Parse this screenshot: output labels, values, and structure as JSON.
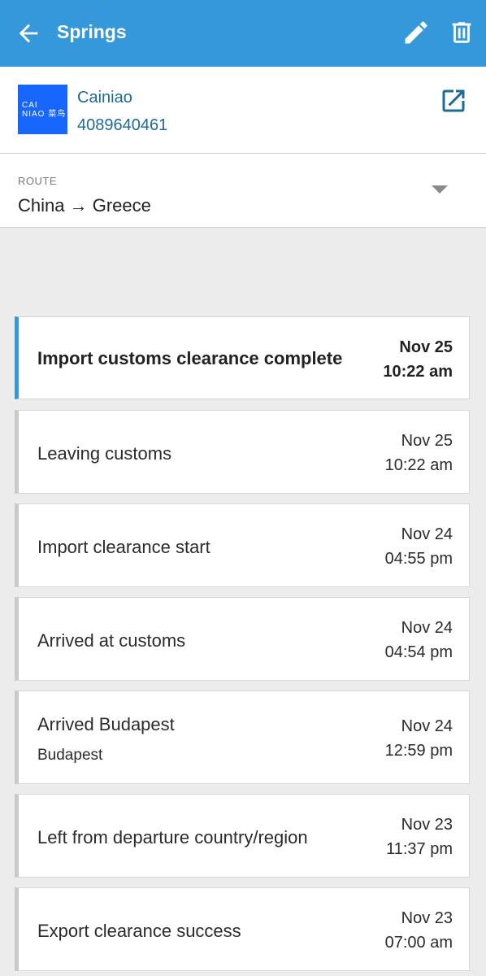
{
  "appbar": {
    "title": "Springs"
  },
  "carrier": {
    "logo_line1": "CAI",
    "logo_line2": "NIAO 菜鸟",
    "name": "Cainiao",
    "tracking_number": "4089640461"
  },
  "route": {
    "label": "ROUTE",
    "value": "China → Greece"
  },
  "events": [
    {
      "title": "Import customs clearance complete",
      "date": "Nov 25",
      "time": "10:22 am",
      "location": ""
    },
    {
      "title": "Leaving customs",
      "date": "Nov 25",
      "time": "10:22 am",
      "location": ""
    },
    {
      "title": "Import clearance start",
      "date": "Nov 24",
      "time": "04:55 pm",
      "location": ""
    },
    {
      "title": "Arrived at customs",
      "date": "Nov 24",
      "time": "04:54 pm",
      "location": ""
    },
    {
      "title": "Arrived Budapest",
      "date": "Nov 24",
      "time": "12:59 pm",
      "location": "Budapest"
    },
    {
      "title": "Left from departure country/region",
      "date": "Nov 23",
      "time": "11:37 pm",
      "location": ""
    },
    {
      "title": "Export clearance success",
      "date": "Nov 23",
      "time": "07:00 am",
      "location": ""
    }
  ],
  "colors": {
    "appbar": "#3598db",
    "link": "#1d6b96",
    "logo": "#1767ff"
  }
}
